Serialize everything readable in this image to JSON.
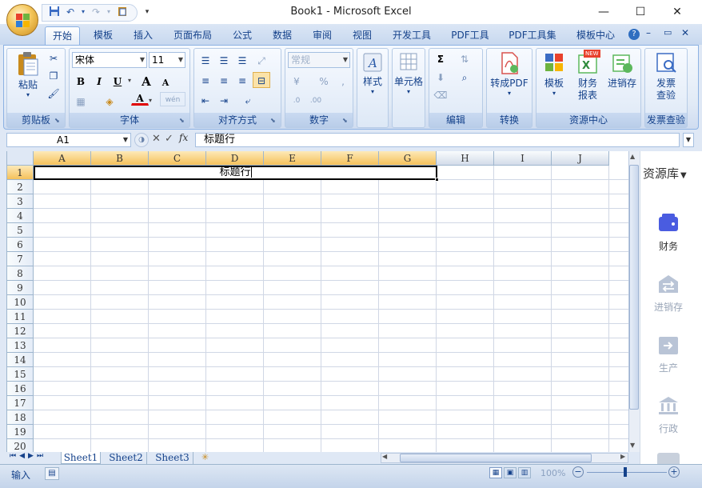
{
  "window": {
    "title": "Book1 - Microsoft Excel",
    "minimize": "—",
    "maximize": "☐",
    "close": "✕"
  },
  "qat": {
    "save": "💾",
    "undo": "↶",
    "redo": "↷",
    "more": "▾"
  },
  "tabs": [
    {
      "label": "开始",
      "active": true
    },
    {
      "label": "模板"
    },
    {
      "label": "插入"
    },
    {
      "label": "页面布局"
    },
    {
      "label": "公式"
    },
    {
      "label": "数据"
    },
    {
      "label": "审阅"
    },
    {
      "label": "视图"
    },
    {
      "label": "开发工具"
    },
    {
      "label": "PDF工具"
    },
    {
      "label": "PDF工具集"
    },
    {
      "label": "模板中心"
    }
  ],
  "ribbon_window_controls": {
    "help": "?",
    "minimize": "–",
    "restore": "▭",
    "close": "✕"
  },
  "groups": {
    "clipboard": {
      "label": "剪贴板",
      "paste": "粘贴"
    },
    "font": {
      "label": "字体",
      "font_name": "宋体",
      "font_size": "11",
      "bold": "B",
      "italic": "I",
      "underline": "U",
      "grow": "A",
      "shrink": "A",
      "font_color_letter": "A",
      "wen": "wén"
    },
    "alignment": {
      "label": "对齐方式"
    },
    "number": {
      "label": "数字",
      "format": "常规",
      "percent": "%"
    },
    "styles": {
      "label": "样式"
    },
    "cells": {
      "label": "单元格"
    },
    "editing": {
      "label": "编辑",
      "sum": "Σ"
    },
    "convert": {
      "label": "转换",
      "to_pdf": "转成PDF"
    },
    "resource_center": {
      "label": "资源中心",
      "template": "模板",
      "finance_line1": "财务",
      "finance_line2": "报表",
      "inventory": "进销存",
      "new_badge": "NEW"
    },
    "invoice": {
      "label": "发票查验",
      "check_line1": "发票",
      "check_line2": "查验"
    }
  },
  "formula_bar": {
    "name_box": "A1",
    "fx": "fx",
    "cancel": "✕",
    "enter": "✓",
    "value": "标题行"
  },
  "grid": {
    "columns": [
      "A",
      "B",
      "C",
      "D",
      "E",
      "F",
      "G",
      "H",
      "I",
      "J"
    ],
    "rows": [
      "1",
      "2",
      "3",
      "4",
      "5",
      "6",
      "7",
      "8",
      "9",
      "10",
      "11",
      "12",
      "13",
      "14",
      "15",
      "16",
      "17",
      "18",
      "19",
      "20"
    ],
    "a1_text": "标题行"
  },
  "sheets": [
    {
      "label": "Sheet1",
      "active": true
    },
    {
      "label": "Sheet2"
    },
    {
      "label": "Sheet3"
    }
  ],
  "resource_panel": {
    "title": "资源库",
    "items": [
      {
        "label": "财务",
        "active": true,
        "color": "#4a5ce0"
      },
      {
        "label": "进销存",
        "color": "#b9c4d6"
      },
      {
        "label": "生产",
        "color": "#b9c4d6"
      },
      {
        "label": "行政",
        "color": "#b9c4d6"
      }
    ]
  },
  "status": {
    "mode": "输入",
    "zoom": "100%"
  },
  "colors": {
    "selection_header": "#f5c15b",
    "ribbon_text": "#15428b",
    "accent": "#4a5ce0"
  }
}
